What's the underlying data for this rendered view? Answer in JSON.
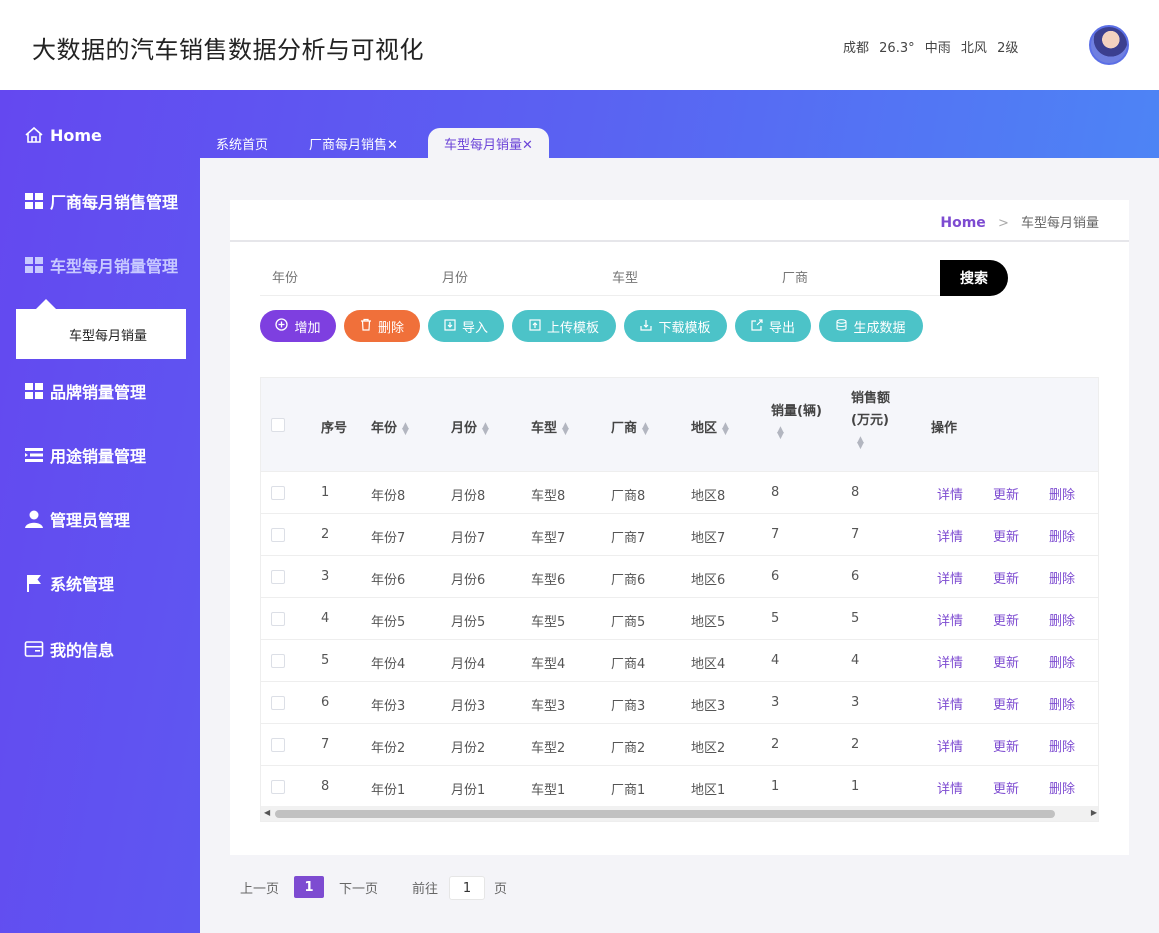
{
  "header": {
    "title": "大数据的汽车销售数据分析与可视化",
    "weather": {
      "city": "成都",
      "temp": "26.3°",
      "condition": "中雨",
      "wind": "北风",
      "level": "2级"
    }
  },
  "sidebar": {
    "items": [
      {
        "label": "Home",
        "icon": "home-icon"
      },
      {
        "label": "厂商每月销售管理",
        "icon": "grid-icon"
      },
      {
        "label": "车型每月销量管理",
        "icon": "grid-icon"
      },
      {
        "label": "品牌销量管理",
        "icon": "grid-icon"
      },
      {
        "label": "用途销量管理",
        "icon": "list-icon"
      },
      {
        "label": "管理员管理",
        "icon": "user-icon"
      },
      {
        "label": "系统管理",
        "icon": "flag-icon"
      },
      {
        "label": "我的信息",
        "icon": "card-icon"
      }
    ],
    "submenu": {
      "label": "车型每月销量"
    }
  },
  "tabs": [
    {
      "label": "系统首页"
    },
    {
      "label": "厂商每月销售✕"
    },
    {
      "label": "车型每月销量✕"
    }
  ],
  "breadcrumb": {
    "home": "Home",
    "sep": ">",
    "current": "车型每月销量"
  },
  "search": {
    "fields": [
      {
        "placeholder": "年份"
      },
      {
        "placeholder": "月份"
      },
      {
        "placeholder": "车型"
      },
      {
        "placeholder": "厂商"
      }
    ],
    "button": "搜索"
  },
  "actions": [
    {
      "label": "增加",
      "color": "#7e3fe0"
    },
    {
      "label": "删除",
      "color": "#f0703a"
    },
    {
      "label": "导入",
      "color": "#4cc3c8"
    },
    {
      "label": "上传模板",
      "color": "#4cc3c8"
    },
    {
      "label": "下载模板",
      "color": "#4cc3c8"
    },
    {
      "label": "导出",
      "color": "#4cc3c8"
    },
    {
      "label": "生成数据",
      "color": "#4cc3c8"
    }
  ],
  "table": {
    "columns": [
      "序号",
      "年份",
      "月份",
      "车型",
      "厂商",
      "地区",
      "销量(辆)",
      "销售额",
      "(万元)",
      "操作"
    ],
    "rows": [
      [
        "1",
        "年份8",
        "月份8",
        "车型8",
        "厂商8",
        "地区8",
        "8",
        "8"
      ],
      [
        "2",
        "年份7",
        "月份7",
        "车型7",
        "厂商7",
        "地区7",
        "7",
        "7"
      ],
      [
        "3",
        "年份6",
        "月份6",
        "车型6",
        "厂商6",
        "地区6",
        "6",
        "6"
      ],
      [
        "4",
        "年份5",
        "月份5",
        "车型5",
        "厂商5",
        "地区5",
        "5",
        "5"
      ],
      [
        "5",
        "年份4",
        "月份4",
        "车型4",
        "厂商4",
        "地区4",
        "4",
        "4"
      ],
      [
        "6",
        "年份3",
        "月份3",
        "车型3",
        "厂商3",
        "地区3",
        "3",
        "3"
      ],
      [
        "7",
        "年份2",
        "月份2",
        "车型2",
        "厂商2",
        "地区2",
        "2",
        "2"
      ],
      [
        "8",
        "年份1",
        "月份1",
        "车型1",
        "厂商1",
        "地区1",
        "1",
        "1"
      ]
    ],
    "ops": [
      "详情",
      "更新",
      "删除"
    ]
  },
  "pagination": {
    "prev": "上一页",
    "page": "1",
    "next": "下一页",
    "goto": "前往",
    "input": "1",
    "unit": "页"
  }
}
